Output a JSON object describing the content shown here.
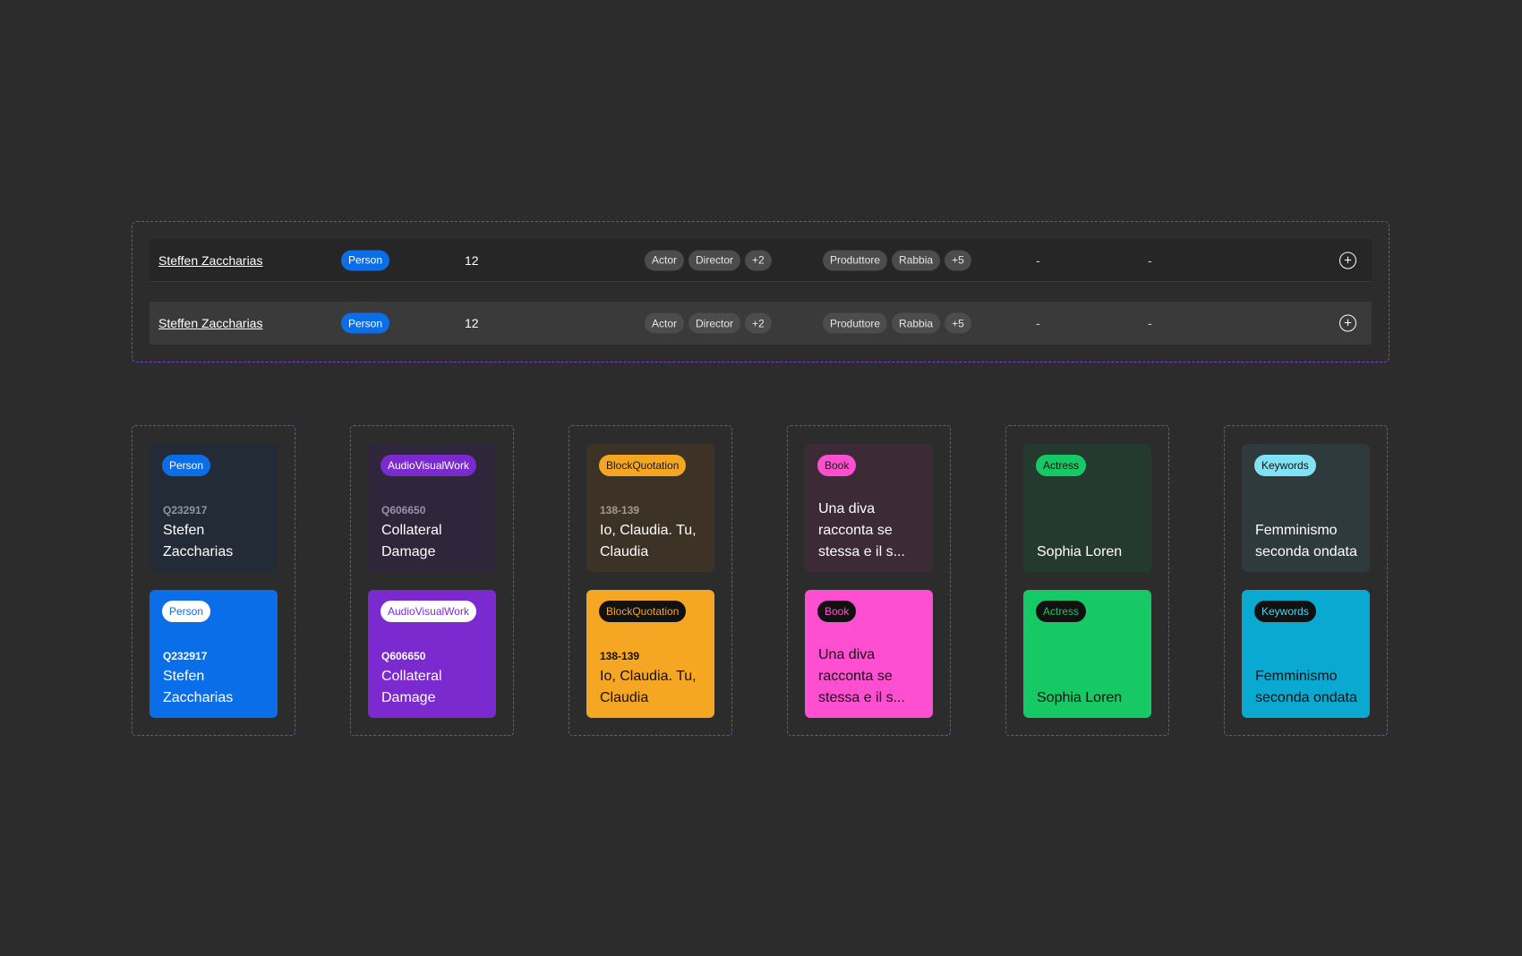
{
  "table": {
    "rows": [
      {
        "name": "Steffen Zaccharias",
        "type": "Person",
        "count": "12",
        "roles": [
          "Actor",
          "Director",
          "+2"
        ],
        "tags": [
          "Produttore",
          "Rabbia",
          "+5"
        ],
        "col7": "-",
        "col8": "-"
      },
      {
        "name": "Steffen Zaccharias",
        "type": "Person",
        "count": "12",
        "roles": [
          "Actor",
          "Director",
          "+2"
        ],
        "tags": [
          "Produttore",
          "Rabbia",
          "+5"
        ],
        "col7": "-",
        "col8": "-"
      }
    ],
    "add_icon": "plus-circle-icon"
  },
  "groups": [
    {
      "light": {
        "badge": "Person",
        "id": "Q232917",
        "title": "Stefen Zaccharias",
        "bg": "#232b37",
        "badge_bg": "#0a6ee8",
        "badge_fg": "#ffffff",
        "id_color": "#8f96a0",
        "title_color": "#ffffff"
      },
      "solid": {
        "badge": "Person",
        "id": "Q232917",
        "title": "Stefen Zaccharias",
        "bg": "#0a6ee8",
        "badge_bg": "#ffffff",
        "badge_fg": "#0a6ee8",
        "id_color": "#ffffff",
        "title_color": "#ffffff"
      }
    },
    {
      "light": {
        "badge": "AudioVisualWork",
        "id": "Q606650",
        "title": "Collateral Damage",
        "bg": "#30263b",
        "badge_bg": "#7b2ad0",
        "badge_fg": "#ffffff",
        "id_color": "#9a92a4",
        "title_color": "#ffffff"
      },
      "solid": {
        "badge": "AudioVisualWork",
        "id": "Q606650",
        "title": "Collateral Damage",
        "bg": "#7b2ad0",
        "badge_bg": "#ffffff",
        "badge_fg": "#7b2ad0",
        "id_color": "#ffffff",
        "title_color": "#ffffff"
      }
    },
    {
      "light": {
        "badge": "BlockQuotation",
        "id": "138-139",
        "title": "Io, Claudia. Tu, Claudia",
        "bg": "#3c3226",
        "badge_bg": "#f5a623",
        "badge_fg": "#1a1a1a",
        "id_color": "#a3998d",
        "title_color": "#ffffff"
      },
      "solid": {
        "badge": "BlockQuotation",
        "id": "138-139",
        "title": "Io, Claudia. Tu, Claudia",
        "bg": "#f5a623",
        "badge_bg": "#111111",
        "badge_fg": "#f5a623",
        "id_color": "#111111",
        "title_color": "#111111"
      }
    },
    {
      "light": {
        "badge": "Book",
        "id": "",
        "title": "Una diva racconta se stessa e il s...",
        "bg": "#3c2a36",
        "badge_bg": "#ff4fd1",
        "badge_fg": "#1a1a1a",
        "id_color": "#a3a3a3",
        "title_color": "#ffffff"
      },
      "solid": {
        "badge": "Book",
        "id": "",
        "title": "Una diva racconta se stessa e il s...",
        "bg": "#ff4fd1",
        "badge_bg": "#111111",
        "badge_fg": "#ff4fd1",
        "id_color": "#111111",
        "title_color": "#111111"
      }
    },
    {
      "light": {
        "badge": "Actress",
        "id": "",
        "title": "Sophia Loren",
        "bg": "#253a2e",
        "badge_bg": "#17c964",
        "badge_fg": "#111111",
        "id_color": "#a3a3a3",
        "title_color": "#ffffff"
      },
      "solid": {
        "badge": "Actress",
        "id": "",
        "title": "Sophia Loren",
        "bg": "#17c964",
        "badge_bg": "#111111",
        "badge_fg": "#17c964",
        "id_color": "#111111",
        "title_color": "#111111"
      }
    },
    {
      "light": {
        "badge": "Keywords",
        "id": "",
        "title": "Femminismo seconda ondata",
        "bg": "#2e3a3c",
        "badge_bg": "#7fe3f5",
        "badge_fg": "#111111",
        "id_color": "#a3a3a3",
        "title_color": "#ffffff"
      },
      "solid": {
        "badge": "Keywords",
        "id": "",
        "title": "Femminismo seconda ondata",
        "bg": "#09a9d1",
        "badge_bg": "#111111",
        "badge_fg": "#4fd6f2",
        "id_color": "#111111",
        "title_color": "#111111"
      }
    }
  ]
}
